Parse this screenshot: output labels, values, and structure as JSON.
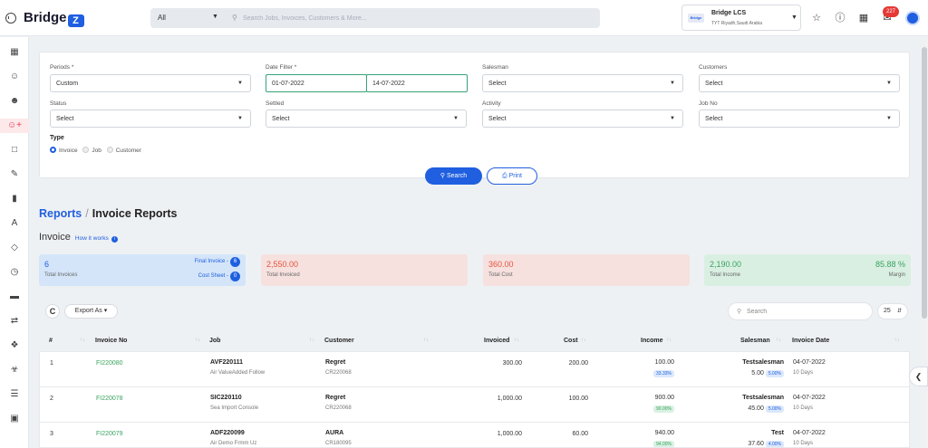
{
  "topbar": {
    "logo_text": "Bridge",
    "logo_mark": "Z",
    "search_category": "All",
    "search_placeholder": "Search Jobs, Invoices, Customers & More...",
    "company_name": "Bridge LCS",
    "company_location": "TYT Riyadh,Saudi Arabia",
    "notification_count": "227",
    "icons": [
      "menu-icon",
      "search-icon",
      "star-icon",
      "help-icon",
      "grid-icon",
      "inbox-icon",
      "avatar"
    ]
  },
  "sidebar": {
    "icons": [
      "dashboard-icon",
      "user-icon",
      "users-icon",
      "user-add-icon",
      "bookmark-icon",
      "edit-icon",
      "bar-chart-icon",
      "font-icon",
      "tag-icon",
      "clock-icon",
      "card-icon",
      "transfer-icon",
      "settings-icon",
      "cart-icon",
      "layers-icon",
      "archive-icon"
    ],
    "active_index": 3
  },
  "filters": {
    "periods": {
      "label": "Periods *",
      "value": "Custom"
    },
    "date_filter": {
      "label": "Date Filter *",
      "from": "01-07-2022",
      "to": "14-07-2022"
    },
    "salesman": {
      "label": "Salesman",
      "value": "Select"
    },
    "customers": {
      "label": "Customers",
      "value": "Select"
    },
    "status": {
      "label": "Status",
      "value": "Select"
    },
    "settled": {
      "label": "Settled",
      "value": "Select"
    },
    "activity": {
      "label": "Activity",
      "value": "Select"
    },
    "job_no": {
      "label": "Job No",
      "value": "Select"
    },
    "type": {
      "label": "Type",
      "options": [
        "Invoice",
        "Job",
        "Customer"
      ],
      "selected": "Invoice"
    },
    "search_label": "Search",
    "print_label": "Print"
  },
  "breadcrumb": {
    "root": "Reports",
    "separator": "/",
    "current": "Invoice Reports"
  },
  "section": {
    "title": "Invoice",
    "help_link": "How it works"
  },
  "stats": {
    "total_invoices": {
      "value": "6",
      "label": "Total Invoices"
    },
    "final_invoice": {
      "label": "Final Invoice -",
      "count": "6"
    },
    "cost_sheet": {
      "label": "Cost Sheet -",
      "count": "0"
    },
    "total_invoiced": {
      "value": "2,550.00",
      "label": "Total Invoiced"
    },
    "total_cost": {
      "value": "360.00",
      "label": "Total Cost"
    },
    "total_income": {
      "value": "2,190.00",
      "label": "Total Income"
    },
    "margin": {
      "value": "85.88 %",
      "label": "Margin"
    }
  },
  "colors": {
    "accent": "#1f5fe0",
    "danger": "#e53935",
    "success": "#3aa35f",
    "stat_blue": "#d4e5f9",
    "stat_red": "#f6e1df",
    "stat_green": "#d9efe2"
  },
  "toolbar": {
    "export_label": "Export As",
    "search_placeholder": "Search",
    "page_size": "25"
  },
  "table": {
    "columns": [
      "#",
      "Invoice No",
      "Job",
      "Customer",
      "Invoiced",
      "Cost",
      "Income",
      "Salesman",
      "Invoice Date"
    ],
    "rows": [
      {
        "num": "1",
        "invoice_no": "FI220080",
        "job": "AVF220111",
        "job_desc": "Air ValueAdded Follow",
        "customer": "Regret",
        "customer_code": "CR220068",
        "invoiced": "300.00",
        "cost": "200.00",
        "income": "100.00",
        "income_pct": "33.33%",
        "salesman": "Testsalesman",
        "commission": "5.00",
        "commission_pct": "5.00%",
        "date": "04-07-2022",
        "days": "10 Days"
      },
      {
        "num": "2",
        "invoice_no": "FI220078",
        "job": "SIC220110",
        "job_desc": "Sea Import Console",
        "customer": "Regret",
        "customer_code": "CR220068",
        "invoiced": "1,000.00",
        "cost": "100.00",
        "income": "900.00",
        "income_pct": "90.00%",
        "salesman": "Testsalesman",
        "commission": "45.00",
        "commission_pct": "5.00%",
        "date": "04-07-2022",
        "days": "10 Days"
      },
      {
        "num": "3",
        "invoice_no": "FI220079",
        "job": "ADF220099",
        "job_desc": "Air Demo Frmm Uz",
        "customer": "AURA",
        "customer_code": "CR180095",
        "invoiced": "1,000.00",
        "cost": "60.00",
        "income": "940.00",
        "income_pct": "94.00%",
        "salesman": "Test",
        "commission": "37.60",
        "commission_pct": "4.00%",
        "date": "04-07-2022",
        "days": "10 Days"
      }
    ]
  }
}
